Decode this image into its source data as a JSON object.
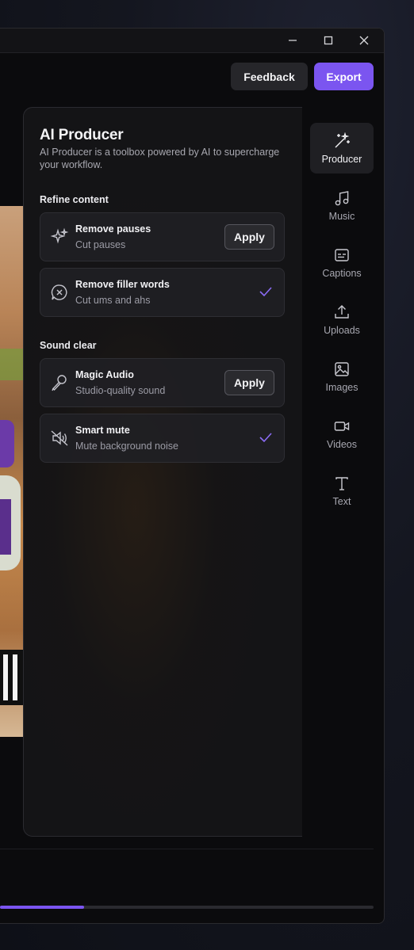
{
  "window_controls": {
    "minimize": "minimize",
    "maximize": "maximize",
    "close": "close"
  },
  "header": {
    "feedback_label": "Feedback",
    "export_label": "Export",
    "accent": "#7b55f0"
  },
  "panel": {
    "title": "AI Producer",
    "description": "AI Producer is a toolbox powered by AI to supercharge your workflow.",
    "sections": [
      {
        "label": "Refine content",
        "items": [
          {
            "title": "Remove pauses",
            "subtitle": "Cut pauses",
            "icon": "sparkle-icon",
            "action": "Apply",
            "applied": false
          },
          {
            "title": "Remove filler words",
            "subtitle": "Cut ums and ahs",
            "icon": "speech-x-icon",
            "action": "",
            "applied": true
          }
        ]
      },
      {
        "label": "Sound clear",
        "items": [
          {
            "title": "Magic Audio",
            "subtitle": "Studio-quality sound",
            "icon": "microphone-icon",
            "action": "Apply",
            "applied": false
          },
          {
            "title": "Smart mute",
            "subtitle": "Mute background noise",
            "icon": "speaker-mute-icon",
            "action": "",
            "applied": true
          }
        ]
      }
    ]
  },
  "sidebar": {
    "items": [
      {
        "label": "Producer",
        "icon": "magic-wand-icon",
        "active": true
      },
      {
        "label": "Music",
        "icon": "music-note-icon",
        "active": false
      },
      {
        "label": "Captions",
        "icon": "captions-icon",
        "active": false
      },
      {
        "label": "Uploads",
        "icon": "upload-icon",
        "active": false
      },
      {
        "label": "Images",
        "icon": "image-icon",
        "active": false
      },
      {
        "label": "Videos",
        "icon": "video-camera-icon",
        "active": false
      },
      {
        "label": "Text",
        "icon": "text-icon",
        "active": false
      }
    ]
  },
  "timeline": {
    "progress": 0.225
  }
}
